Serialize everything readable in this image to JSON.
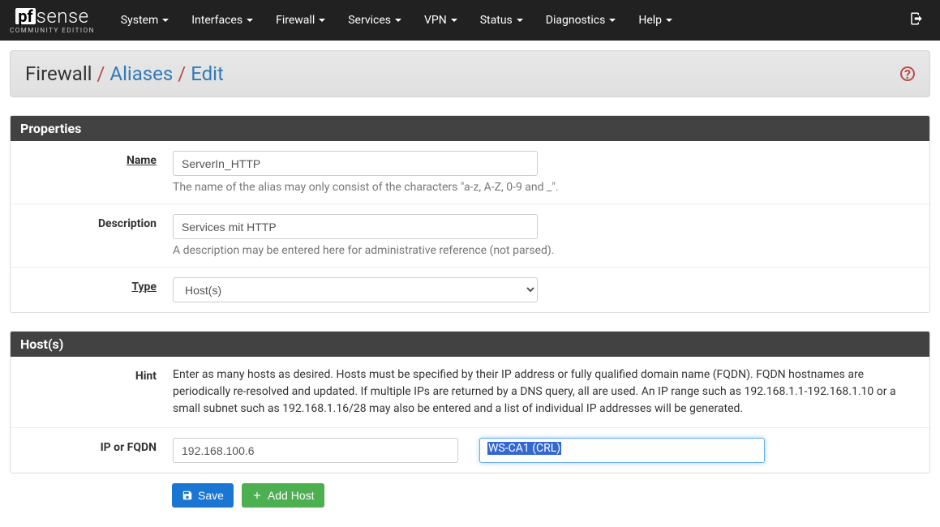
{
  "brand": {
    "pf": "pf",
    "sense": "sense",
    "sub": "COMMUNITY EDITION"
  },
  "nav": [
    "System",
    "Interfaces",
    "Firewall",
    "Services",
    "VPN",
    "Status",
    "Diagnostics",
    "Help"
  ],
  "breadcrumb": {
    "root": "Firewall",
    "mid": "Aliases",
    "leaf": "Edit"
  },
  "panels": {
    "properties": {
      "title": "Properties",
      "name": {
        "label": "Name",
        "value": "ServerIn_HTTP",
        "help": "The name of the alias may only consist of the characters \"a-z, A-Z, 0-9 and _\"."
      },
      "description": {
        "label": "Description",
        "value": "Services mit HTTP",
        "help": "A description may be entered here for administrative reference (not parsed)."
      },
      "type": {
        "label": "Type",
        "value": "Host(s)"
      }
    },
    "hosts": {
      "title": "Host(s)",
      "hint": {
        "label": "Hint",
        "text": "Enter as many hosts as desired. Hosts must be specified by their IP address or fully qualified domain name (FQDN). FQDN hostnames are periodically re-resolved and updated. If multiple IPs are returned by a DNS query, all are used. An IP range such as 192.168.1.1-192.168.1.10 or a small subnet such as 192.168.1.16/28 may also be entered and a list of individual IP addresses will be generated."
      },
      "ip": {
        "label": "IP or FQDN",
        "value": "192.168.100.6",
        "desc": "WS-CA1 (CRL)"
      }
    }
  },
  "buttons": {
    "save": "Save",
    "add": "Add Host"
  }
}
